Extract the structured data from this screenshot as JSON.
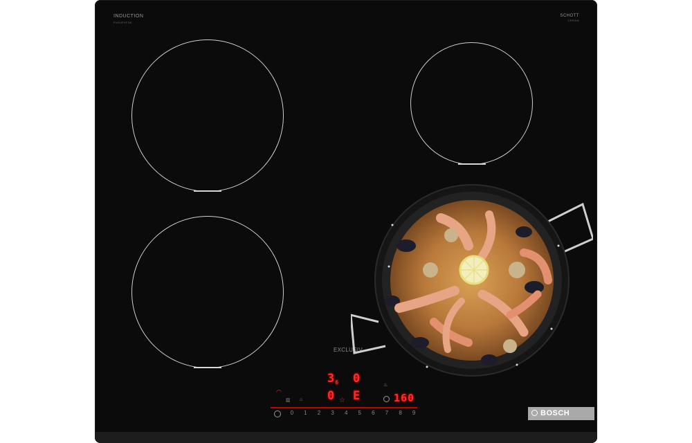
{
  "cooktop": {
    "brand_left": "INDUCTION",
    "brand_left_sub": "PXE0F4F38",
    "brand_right": "SCHOTT",
    "brand_right_sub": "CERAN",
    "series_label": "EXCLUSIV",
    "logo_text": "BOSCH"
  },
  "display": {
    "zone_front_left_level": "3",
    "zone_front_left_sub": "6",
    "zone_rear_right_level": "0",
    "zone_rear_left_level": "0",
    "zone_center_code": "E",
    "timer_value": "160"
  },
  "controls": {
    "scale": [
      "0",
      "1",
      "2",
      "3",
      "4",
      "5",
      "6",
      "7",
      "8",
      "9"
    ],
    "icons": [
      "wifi-icon",
      "combi-zone-icon",
      "boost-icon",
      "favorite-icon",
      "timer-icon",
      "power-icon",
      "pan-icon"
    ]
  }
}
